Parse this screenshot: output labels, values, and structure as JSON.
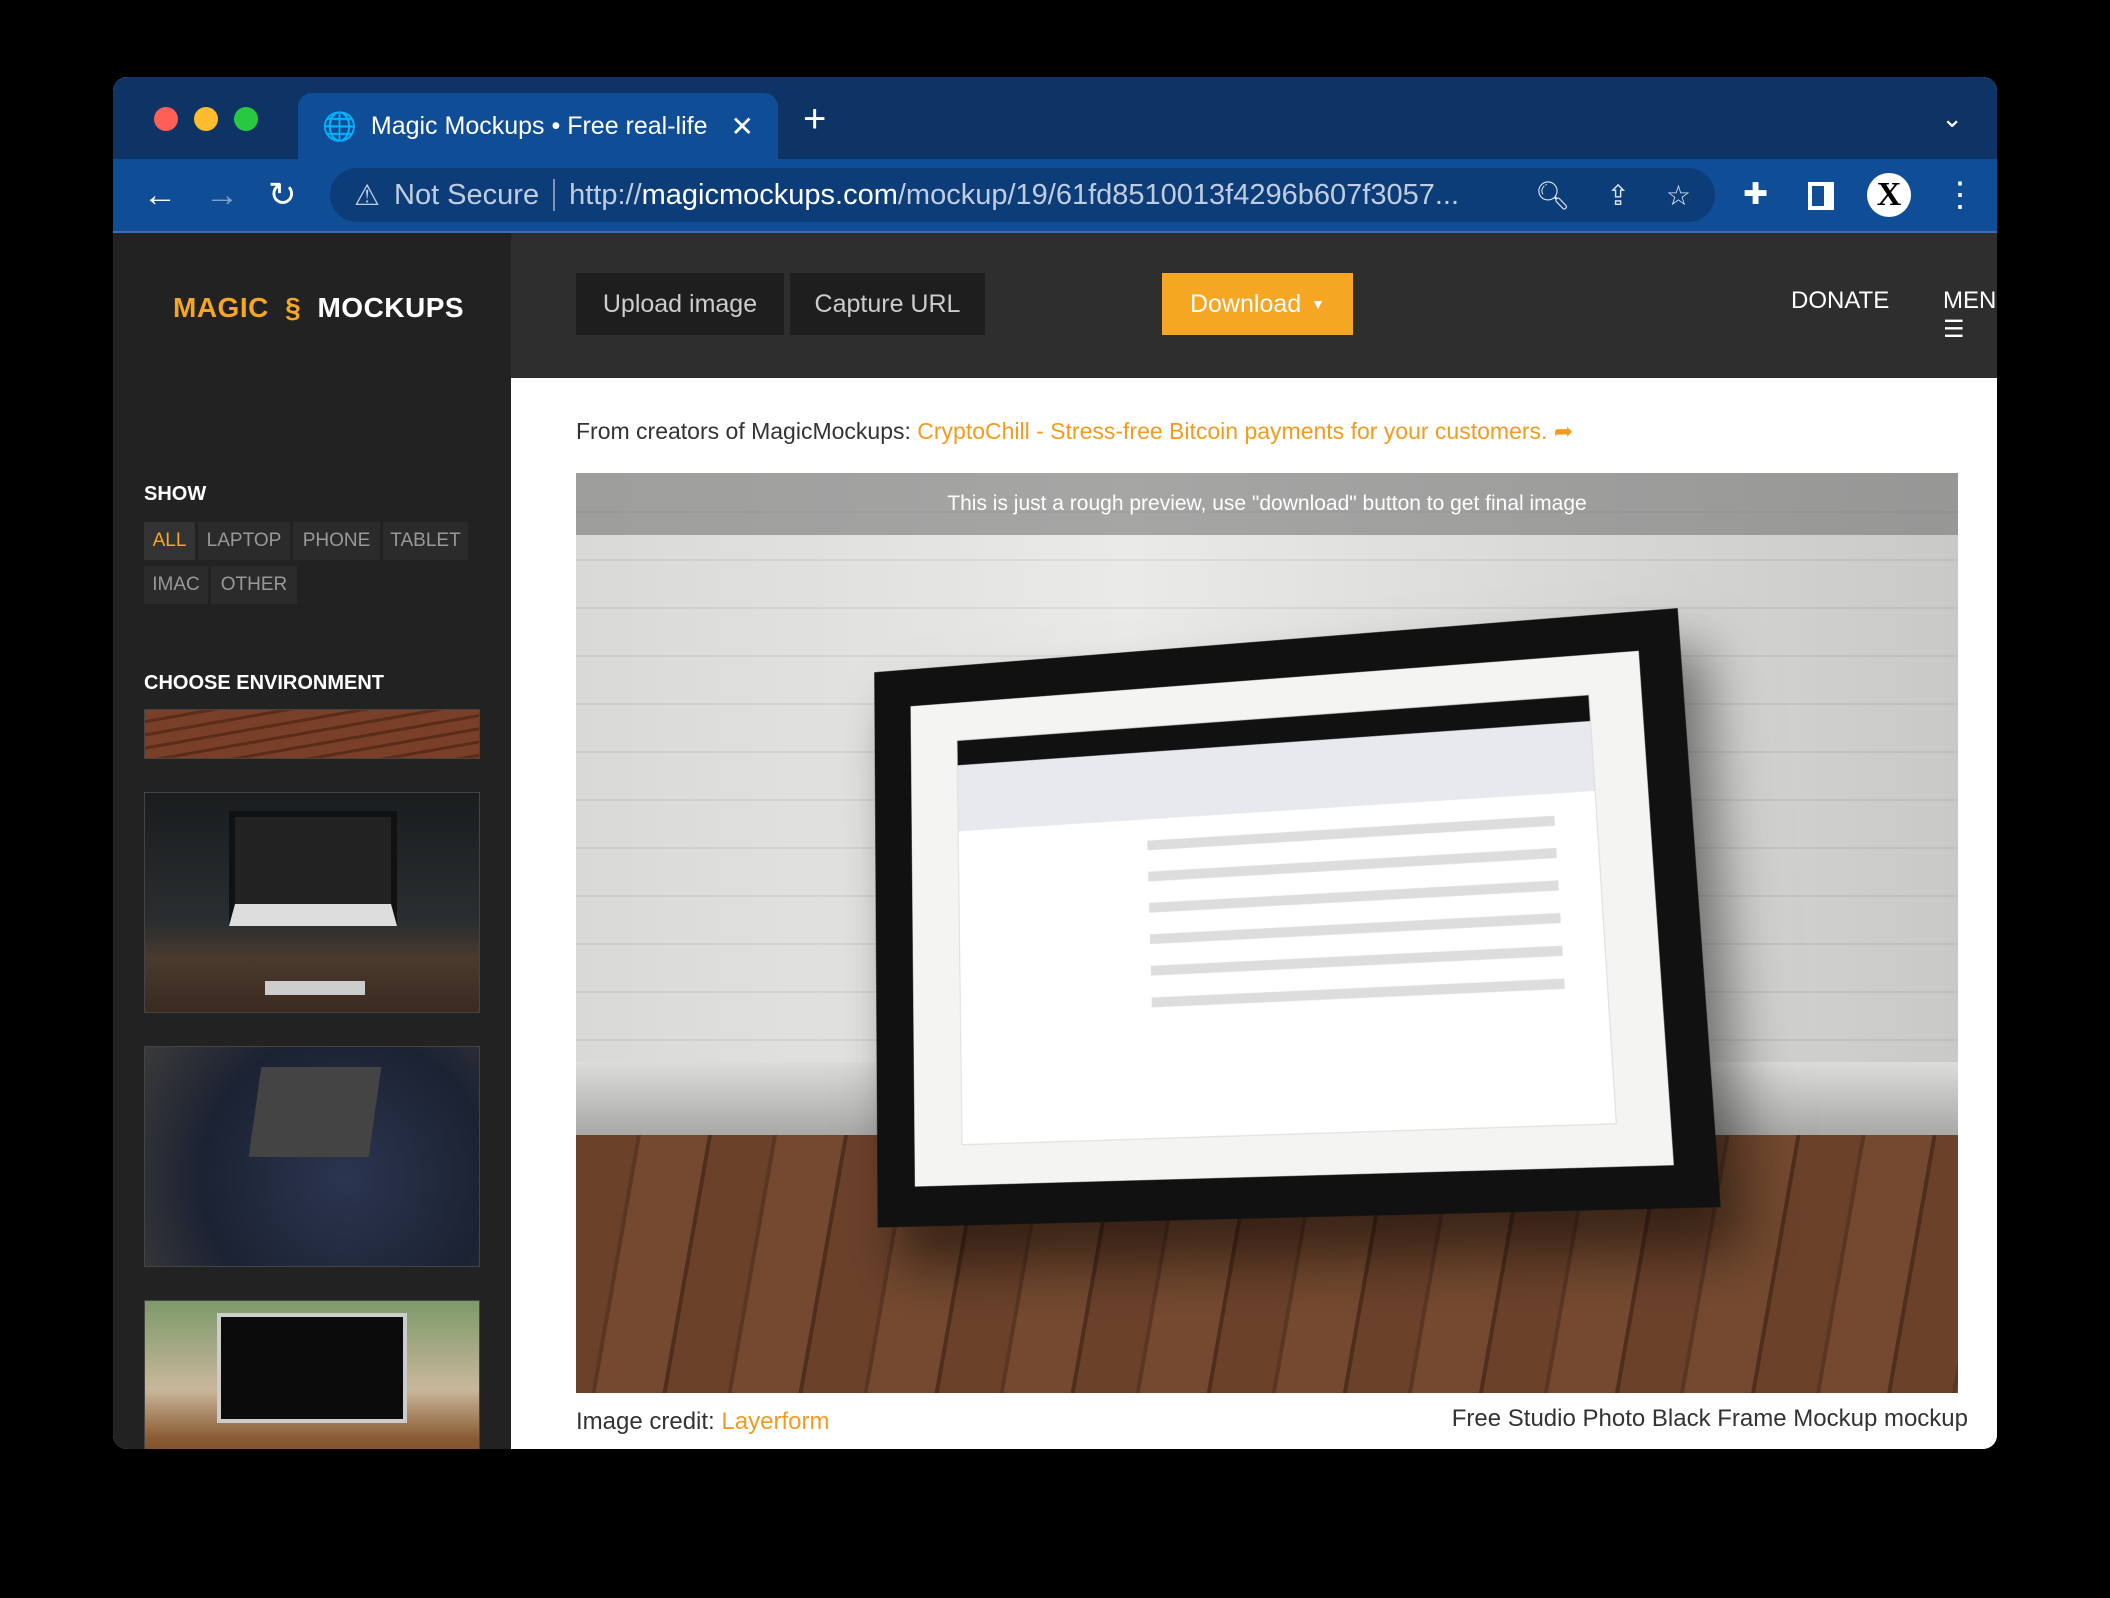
{
  "browser": {
    "tab_title": "Magic Mockups • Free real-life",
    "new_tab": "+",
    "address": {
      "security": "Not Secure",
      "url_scheme": "http://",
      "url_host": "magicmockups.com",
      "url_path": "/mockup/19/61fd8510013f4296b607f3057..."
    },
    "profile_initial": "X"
  },
  "logo": {
    "left": "MAGIC",
    "right": "MOCKUPS"
  },
  "header": {
    "upload": "Upload image",
    "capture": "Capture URL",
    "download": "Download",
    "donate": "DONATE",
    "menu": "MENU"
  },
  "sidebar": {
    "show_title": "SHOW",
    "filters": [
      {
        "label": "ALL",
        "active": true
      },
      {
        "label": "LAPTOP"
      },
      {
        "label": "PHONE"
      },
      {
        "label": "TABLET"
      },
      {
        "label": "IMAC"
      },
      {
        "label": "OTHER"
      }
    ],
    "env_title": "CHOOSE ENVIRONMENT"
  },
  "main": {
    "promo_prefix": "From creators of MagicMockups: ",
    "promo_link": "CryptoChill - Stress-free Bitcoin payments for your customers.",
    "preview_notice": "This is just a rough preview, use \"download\" button to get final image",
    "credit_label": "Image credit: ",
    "credit_link": "Layerform",
    "mockup_title": "Free Studio Photo Black Frame Mockup mockup"
  },
  "colors": {
    "accent": "#f5a623",
    "chrome": "#0f4e96",
    "sidebar": "#222222",
    "header": "#2e2e2e"
  }
}
